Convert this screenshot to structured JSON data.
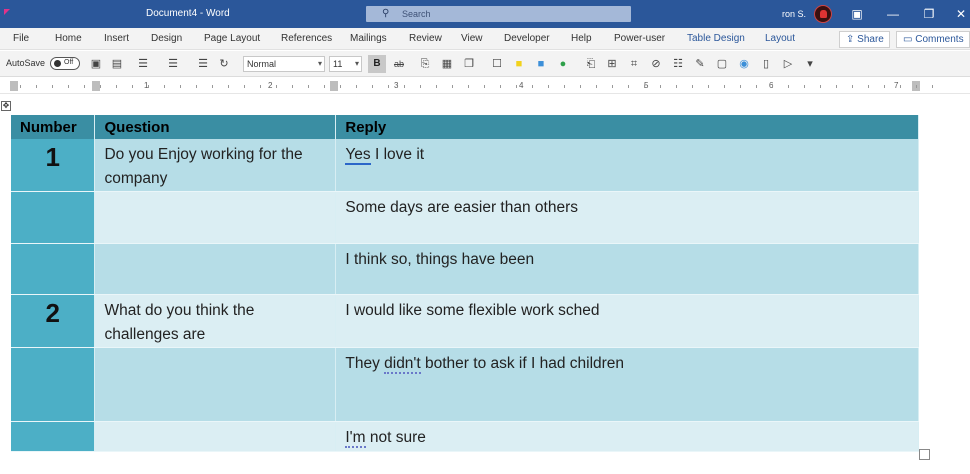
{
  "window": {
    "doc_title": "Document4  -  Word",
    "search_placeholder": "Search",
    "user_name": "ron S.",
    "controls": {
      "ribbon_display": "▣",
      "minimize": "—",
      "restore": "❐",
      "close": "✕"
    }
  },
  "menu": {
    "items": [
      "File",
      "Home",
      "Insert",
      "Design",
      "Page Layout",
      "References",
      "Mailings",
      "Review",
      "View",
      "Developer",
      "Help",
      "Power-user",
      "Table Design",
      "Layout"
    ],
    "share_label": "Share",
    "comments_label": "Comments"
  },
  "toolbar": {
    "autosave_label": "AutoSave",
    "autosave_state": "Off",
    "style_value": "Normal",
    "font_size_value": "11",
    "bold_label": "B",
    "strike_label": "ab"
  },
  "ruler": {
    "numbers": [
      "1",
      "2",
      "3",
      "4",
      "5",
      "6",
      "7"
    ]
  },
  "table": {
    "headers": {
      "number": "Number",
      "question": "Question",
      "reply": "Reply"
    },
    "rows": [
      {
        "number": "1",
        "question": "Do you Enjoy working for the company",
        "reply_first": "Yes",
        "reply_rest": " I love it"
      },
      {
        "number": "",
        "question": "",
        "reply": "Some days are easier than others"
      },
      {
        "number": "",
        "question": "",
        "reply": "I think so, things have been"
      },
      {
        "number": "2",
        "question": "What do you think the challenges are",
        "reply": "I would like some flexible work sched"
      },
      {
        "number": "",
        "question": "",
        "reply_pre": "They ",
        "reply_flag": "didn't",
        "reply_post": " bother to ask if I had children"
      },
      {
        "number": "",
        "question": "",
        "reply_flag": "I'm",
        "reply_post": " not sure"
      }
    ]
  },
  "colors": {
    "title_bar": "#2b579a",
    "header_row": "#3a8ea3",
    "number_column": "#4cafc6",
    "row_dark": "#b6dde7",
    "row_light": "#dbeef3"
  }
}
